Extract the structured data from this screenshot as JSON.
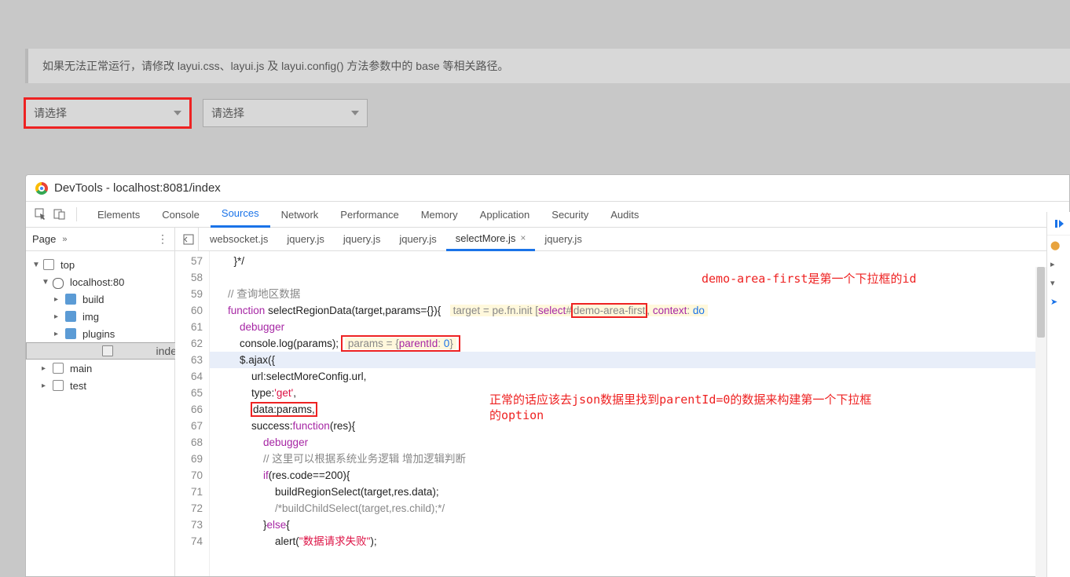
{
  "topPanel": {
    "note": "如果无法正常运行，请修改 layui.css、layui.js 及 layui.config() 方法参数中的 base 等相关路径。",
    "select1": "请选择",
    "select2": "请选择"
  },
  "devtools": {
    "title": "DevTools - localhost:8081/index",
    "mainTabs": [
      "Elements",
      "Console",
      "Sources",
      "Network",
      "Performance",
      "Memory",
      "Application",
      "Security",
      "Audits"
    ],
    "activeMainTab": 2,
    "leftPane": {
      "label": "Page",
      "tree": [
        {
          "depth": 0,
          "kind": "folder-outline",
          "label": "top",
          "arrow": "▼"
        },
        {
          "depth": 1,
          "kind": "cloud",
          "label": "localhost:80",
          "arrow": "▼"
        },
        {
          "depth": 2,
          "kind": "folder",
          "label": "build",
          "arrow": "▸"
        },
        {
          "depth": 2,
          "kind": "folder",
          "label": "img",
          "arrow": "▸"
        },
        {
          "depth": 2,
          "kind": "folder-open",
          "label": "plugins",
          "arrow": "▸"
        },
        {
          "depth": 2,
          "kind": "file",
          "label": "index",
          "arrow": "",
          "selected": true
        },
        {
          "depth": 1,
          "kind": "folder-outline",
          "label": "main",
          "arrow": "▸"
        },
        {
          "depth": 1,
          "kind": "folder-outline",
          "label": "test",
          "arrow": "▸"
        }
      ]
    },
    "fileTabs": [
      "websocket.js",
      "jquery.js",
      "jquery.js",
      "jquery.js",
      "selectMore.js",
      "jquery.js"
    ],
    "activeFileTab": 4,
    "activeFileTabClose": "×",
    "code": {
      "startLine": 57,
      "lines": [
        {
          "n": 57,
          "html": "      }*/"
        },
        {
          "n": 58,
          "html": ""
        },
        {
          "n": 59,
          "html": "    <span class='c-comm'>// 查询地区数据</span>"
        },
        {
          "n": 60,
          "html": "    <span class='c-kw'>function</span> selectRegionData(target,params={}){   <span class='inline-val'>target = pe.fn.init [<span class='k'>select</span>#<span class='redbox' style='padding:1px 2px'>demo-area-first</span>, <span class='k'>context</span>: <span class='v'>do</span></span>"
        },
        {
          "n": 61,
          "html": "        <span class='c-kw'>debugger</span>"
        },
        {
          "n": 62,
          "html": "        console.log(params); <span class='redbox' style='padding:2px 4px'><span class='inline-val'>params = {<span class='k'>parentId</span>: <span class='v'>0</span>}</span></span>"
        },
        {
          "n": 63,
          "html": "        $.ajax({",
          "hl": true
        },
        {
          "n": 64,
          "html": "            url:selectMoreConfig.url,"
        },
        {
          "n": 65,
          "html": "            type:<span class='c-str'>'get'</span>,"
        },
        {
          "n": 66,
          "html": "            <span class='redbox' style='padding:1px 2px'>data:params,</span>"
        },
        {
          "n": 67,
          "html": "            success:<span class='c-kw'>function</span>(res){"
        },
        {
          "n": 68,
          "html": "                <span class='c-kw'>debugger</span>"
        },
        {
          "n": 69,
          "html": "                <span class='c-comm'>// 这里可以根据系统业务逻辑 增加逻辑判断</span>"
        },
        {
          "n": 70,
          "html": "                <span class='c-kw'>if</span>(res.code==200){"
        },
        {
          "n": 71,
          "html": "                    buildRegionSelect(target,res.data);"
        },
        {
          "n": 72,
          "html": "                    <span class='c-comm'>/*buildChildSelect(target,res.child);*/</span>"
        },
        {
          "n": 73,
          "html": "                }<span class='c-kw'>else</span>{"
        },
        {
          "n": 74,
          "html": "                    alert(<span class='c-str'>\"数据请求失败\"</span>);"
        }
      ]
    },
    "annotations": {
      "a1": "demo-area-first是第一个下拉框的id",
      "a2_line1": "正常的话应该去json数据里找到parentId=0的数据来构建第一个下拉框",
      "a2_line2": "的option"
    }
  }
}
